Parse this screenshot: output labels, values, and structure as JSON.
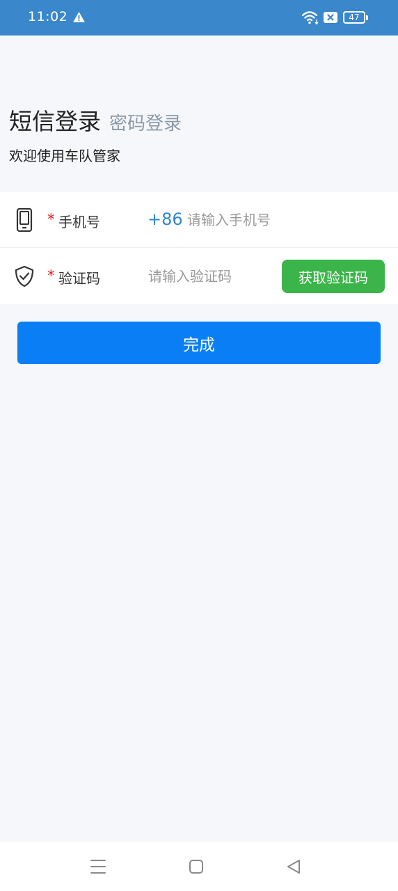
{
  "status_bar": {
    "time": "11:02",
    "battery": "47",
    "icons": [
      "warning-icon",
      "wifi-icon",
      "sim-icon",
      "battery-icon"
    ]
  },
  "login": {
    "tab_sms": "短信登录",
    "tab_password": "密码登录",
    "welcome": "欢迎使用车队管家"
  },
  "form": {
    "phone": {
      "required_mark": "*",
      "label": "手机号",
      "country_code": "+86",
      "placeholder": "请输入手机号",
      "value": ""
    },
    "code": {
      "required_mark": "*",
      "label": "验证码",
      "placeholder": "请输入验证码",
      "value": "",
      "get_code_label": "获取验证码"
    }
  },
  "submit_label": "完成",
  "colors": {
    "status_bar": "#3a87cc",
    "primary": "#0a7ff5",
    "success": "#3bb54a",
    "required": "#e02020",
    "link_blue": "#2e86d6"
  }
}
